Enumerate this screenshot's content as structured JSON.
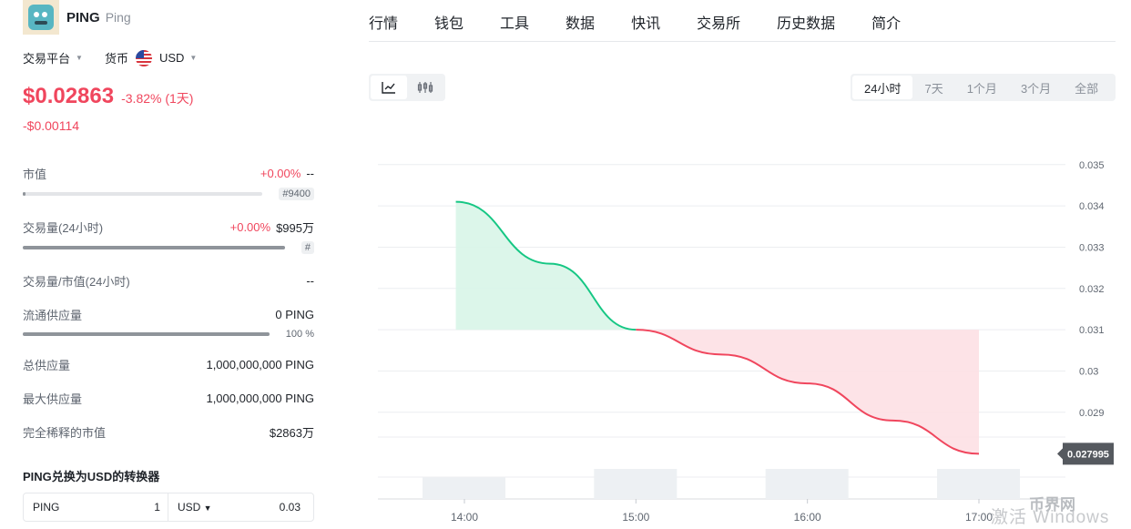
{
  "coin": {
    "symbol": "PING",
    "name": "Ping"
  },
  "selectors": {
    "platform": "交易平台",
    "currency_label": "货币",
    "currency": "USD"
  },
  "price": {
    "value": "$0.02863",
    "change": "-3.82% (1天)",
    "change_abs": "-$0.00114"
  },
  "stats": {
    "market_cap": {
      "label": "市值",
      "change": "+0.00%",
      "value": "--",
      "rank": "#9400",
      "bar": 0.01
    },
    "volume": {
      "label": "交易量(24小时)",
      "change": "+0.00%",
      "value": "$995万",
      "rank": "#",
      "bar": 1.0
    },
    "vol_mcap": {
      "label": "交易量/市值(24小时)",
      "value": "--"
    },
    "circulating": {
      "label": "流通供应量",
      "value": "0 PING",
      "pct": "100 %",
      "bar": 1.0
    },
    "total_supply": {
      "label": "总供应量",
      "value": "1,000,000,000 PING"
    },
    "max_supply": {
      "label": "最大供应量",
      "value": "1,000,000,000 PING"
    },
    "fdv": {
      "label": "完全稀释的市值",
      "value": "$2863万"
    }
  },
  "converter": {
    "title": "PING兑换为USD的转换器",
    "from_symbol": "PING",
    "from_amount": "1",
    "to_symbol": "USD",
    "to_amount": "0.03"
  },
  "tabs": [
    "行情",
    "钱包",
    "工具",
    "数据",
    "快讯",
    "交易所",
    "历史数据",
    "简介"
  ],
  "active_tab": 0,
  "chart_types": {
    "line": "line-chart-icon",
    "candle": "candlestick-icon"
  },
  "ranges": [
    "24小时",
    "7天",
    "1个月",
    "3个月",
    "全部"
  ],
  "active_range": 0,
  "colors": {
    "up": "#16c784",
    "down": "#f0465d",
    "accent": "#f3a31b"
  },
  "chart_data": {
    "type": "area",
    "x": [
      "13:57",
      "14:30",
      "15:00",
      "15:30",
      "16:00",
      "16:30",
      "17:00"
    ],
    "y": [
      0.0341,
      0.0326,
      0.031,
      0.0304,
      0.0297,
      0.0288,
      0.027995
    ],
    "baseline": 0.031,
    "current_label": "0.027995",
    "xticks": [
      "14:00",
      "15:00",
      "16:00",
      "17:00"
    ],
    "yticks": [
      "0.035",
      "0.034",
      "0.033",
      "0.032",
      "0.031",
      "0.03",
      "0.029"
    ],
    "ylim": [
      0.0269,
      0.0359
    ],
    "volume": [
      0.55,
      0.75,
      0.75,
      0.75
    ],
    "grid": true
  },
  "watermark": {
    "text": "激活 Windows",
    "logo": "币界网"
  }
}
